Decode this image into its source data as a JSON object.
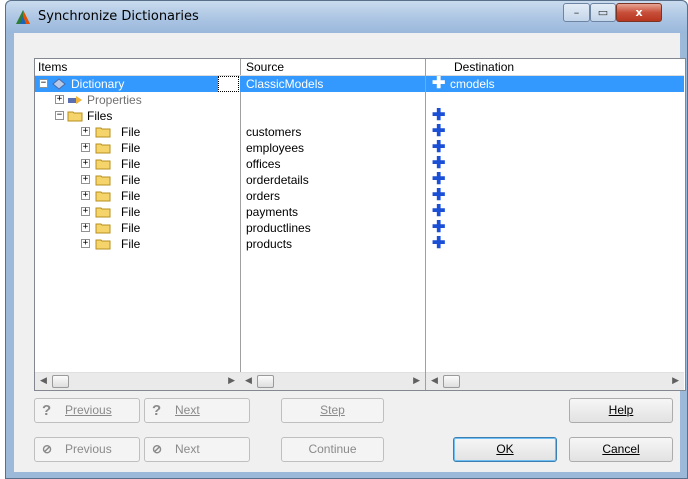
{
  "window": {
    "title": "Synchronize Dictionaries",
    "controls": {
      "minimize": "–",
      "maximize": "▭",
      "close": "x"
    }
  },
  "grid": {
    "headers": {
      "items": "Items",
      "source": "Source",
      "destination": "Destination"
    },
    "root": {
      "label": "Dictionary",
      "source": "ClassicModels",
      "destination": "cmodels"
    },
    "properties_label": "Properties",
    "files_label": "Files",
    "file_label": "File",
    "files": [
      {
        "source": "customers"
      },
      {
        "source": "employees"
      },
      {
        "source": "offices"
      },
      {
        "source": "orderdetails"
      },
      {
        "source": "orders"
      },
      {
        "source": "payments"
      },
      {
        "source": "productlines"
      },
      {
        "source": "products"
      }
    ]
  },
  "buttons": {
    "prev_question": "Previous",
    "next_question": "Next",
    "step": "Step",
    "help": "Help",
    "prev_diff": "Previous",
    "next_diff": "Next",
    "continue": "Continue",
    "ok": "OK",
    "cancel": "Cancel"
  },
  "icons": {
    "app": "triangle-app-icon",
    "dictionary": "dictionary-icon",
    "properties": "properties-icon",
    "folder": "folder-icon",
    "add": "blue-plus-icon",
    "question": "question-icon",
    "no": "no-entry-icon"
  },
  "colors": {
    "selection": "#3399ff",
    "plus": "#1a4fd6",
    "folder": "#f5d46b"
  }
}
